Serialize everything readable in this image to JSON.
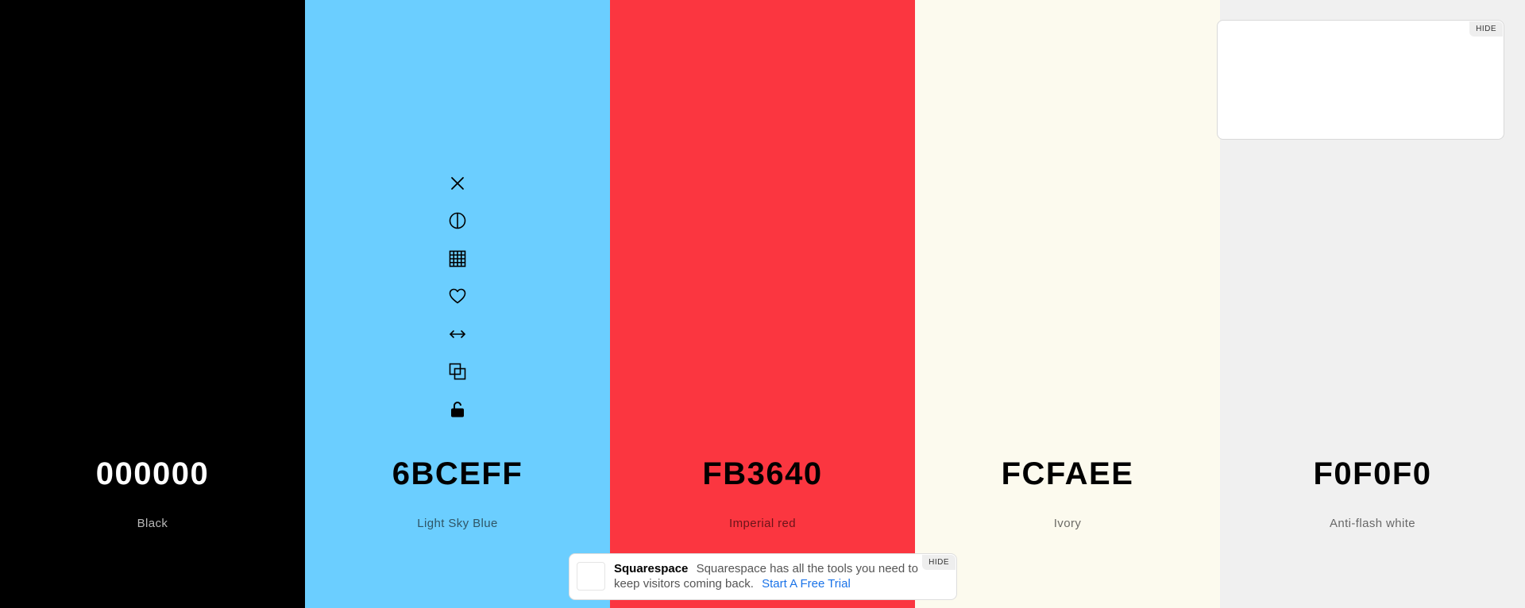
{
  "palette": {
    "colors": [
      {
        "hex": "000000",
        "name": "Black"
      },
      {
        "hex": "6BCEFF",
        "name": "Light Sky Blue"
      },
      {
        "hex": "FB3640",
        "name": "Imperial red"
      },
      {
        "hex": "FCFAEE",
        "name": "Ivory"
      },
      {
        "hex": "F0F0F0",
        "name": "Anti-flash white"
      }
    ]
  },
  "toolbar": {
    "icons": [
      "close-icon",
      "contrast-icon",
      "shades-grid-icon",
      "heart-icon",
      "drag-arrows-icon",
      "copy-icon",
      "unlock-icon"
    ]
  },
  "ads": {
    "top": {
      "hide_label": "HIDE"
    },
    "bottom": {
      "hide_label": "HIDE",
      "brand": "Squarespace",
      "text": "Squarespace has all the tools you need to keep visitors coming back.",
      "cta": "Start A Free Trial"
    }
  }
}
